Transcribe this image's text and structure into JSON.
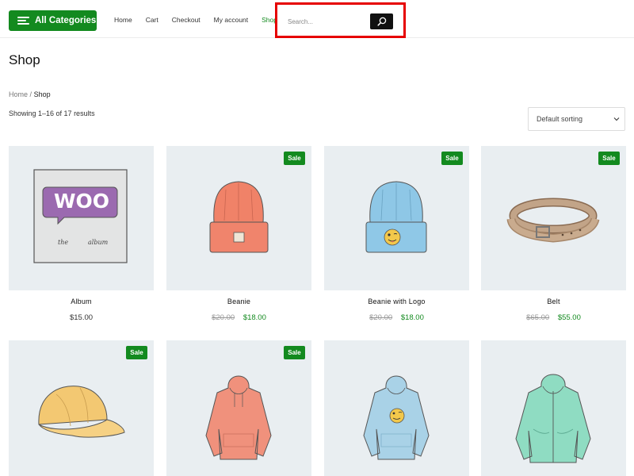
{
  "header": {
    "categories_label": "All Categories",
    "nav": [
      "Home",
      "Cart",
      "Checkout",
      "My account",
      "Shop"
    ],
    "active_nav": "Shop",
    "search_placeholder": "Search..."
  },
  "page": {
    "title": "Shop",
    "breadcrumb": {
      "home": "Home",
      "separator": "/",
      "current": "Shop"
    },
    "result_count": "Showing 1–16 of 17 results",
    "sort_label": "Default sorting"
  },
  "colors": {
    "accent": "#138a1f",
    "highlight": "#e60000"
  },
  "products": [
    {
      "name": "Album",
      "sale": false,
      "sale_label": "",
      "price": "$15.00",
      "old_price": ""
    },
    {
      "name": "Beanie",
      "sale": true,
      "sale_label": "Sale",
      "price": "$18.00",
      "old_price": "$20.00"
    },
    {
      "name": "Beanie with Logo",
      "sale": true,
      "sale_label": "Sale",
      "price": "$18.00",
      "old_price": "$20.00"
    },
    {
      "name": "Belt",
      "sale": true,
      "sale_label": "Sale",
      "price": "$55.00",
      "old_price": "$65.00"
    },
    {
      "name": "",
      "sale": true,
      "sale_label": "Sale",
      "price": "",
      "old_price": ""
    },
    {
      "name": "",
      "sale": true,
      "sale_label": "Sale",
      "price": "",
      "old_price": ""
    },
    {
      "name": "",
      "sale": false,
      "sale_label": "",
      "price": "",
      "old_price": ""
    },
    {
      "name": "",
      "sale": false,
      "sale_label": "",
      "price": "",
      "old_price": ""
    }
  ],
  "album_art": {
    "logo_text": "WOO",
    "subtitle_left": "the",
    "subtitle_right": "album"
  }
}
